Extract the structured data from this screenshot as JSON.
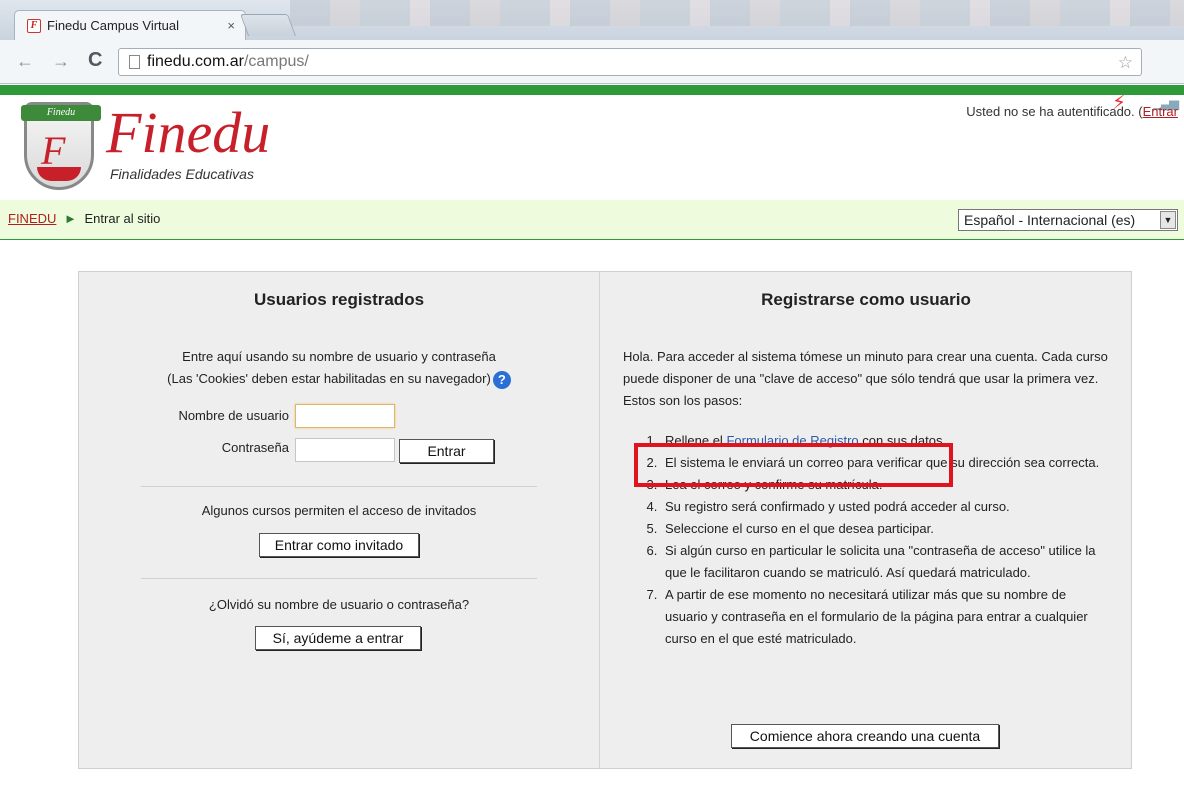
{
  "browser": {
    "tab_title": "Finedu Campus Virtual",
    "tab_close": "×",
    "url_host": "finedu.com.ar",
    "url_path": "/campus/"
  },
  "header": {
    "logo_banner": "Finedu",
    "logo_letter": "F",
    "logo_word": "Finedu",
    "logo_tagline": "Finalidades Educativas",
    "login_status": "Usted no se ha autentificado. (",
    "login_link": "Entrar"
  },
  "navbar": {
    "home_link": "FINEDU",
    "separator": "►",
    "current": "Entrar al sitio",
    "language": "Español - Internacional (es)"
  },
  "left": {
    "title": "Usuarios registrados",
    "intro_line1": "Entre aquí usando su nombre de usuario y contraseña",
    "intro_line2": "(Las 'Cookies' deben estar habilitadas en su navegador)",
    "username_label": "Nombre de usuario",
    "password_label": "Contraseña",
    "login_button": "Entrar",
    "guest_text": "Algunos cursos permiten el acceso de invitados",
    "guest_button": "Entrar como invitado",
    "forgot_text": "¿Olvidó su nombre de usuario o contraseña?",
    "forgot_button": "Sí, ayúdeme a entrar"
  },
  "right": {
    "title": "Registrarse como usuario",
    "intro": "Hola. Para acceder al sistema tómese un minuto para crear una cuenta. Cada curso puede disponer de una \"clave de acceso\" que sólo tendrá que usar la primera vez. Estos son los pasos:",
    "step1_pre": "Rellene el ",
    "step1_link": "Formulario de Registro",
    "step1_post": " con sus datos.",
    "steps": [
      "El sistema le enviará un correo para verificar que su dirección sea correcta.",
      "Lea el correo y confirme su matrícula.",
      "Su registro será confirmado y usted podrá acceder al curso.",
      "Seleccione el curso en el que desea participar.",
      "Si algún curso en particular le solicita una \"contraseña de acceso\" utilice la que le facilitaron cuando se matriculó. Así quedará matriculado.",
      "A partir de ese momento no necesitará utilizar más que su nombre de usuario y contraseña en el formulario de la página para entrar a cualquier curso en el que esté matriculado."
    ],
    "signup_button": "Comience ahora creando una cuenta"
  }
}
